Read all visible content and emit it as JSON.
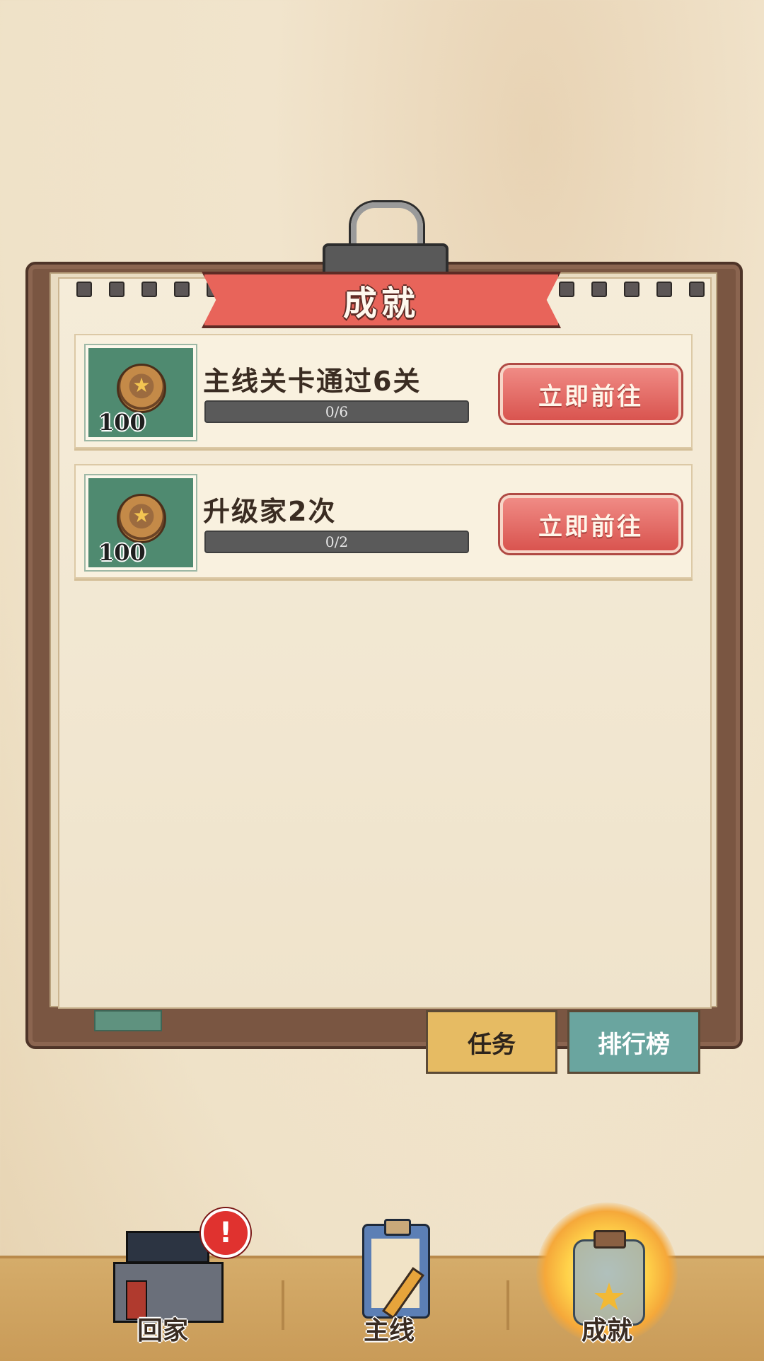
{
  "panel": {
    "title": "成就"
  },
  "achievements": [
    {
      "title": "主线关卡通过6关",
      "reward": "100",
      "progress_text": "0/6",
      "progress": 0,
      "button": "立即前往"
    },
    {
      "title": "升级家2次",
      "reward": "100",
      "progress_text": "0/2",
      "progress": 0,
      "button": "立即前往"
    }
  ],
  "side_tabs": {
    "task": "任务",
    "ranking": "排行榜"
  },
  "bottom_nav": {
    "home": {
      "label": "回家",
      "badge": "!"
    },
    "main": {
      "label": "主线"
    },
    "achievement": {
      "label": "成就",
      "active": true
    }
  },
  "colors": {
    "go_button": "#d9544f",
    "title_ribbon": "#e8645a",
    "reward_bg": "#4f8a70"
  },
  "icons": [
    "medal-star-icon",
    "house-icon",
    "alert-badge-icon",
    "clipboard-icon",
    "star-jar-icon"
  ]
}
